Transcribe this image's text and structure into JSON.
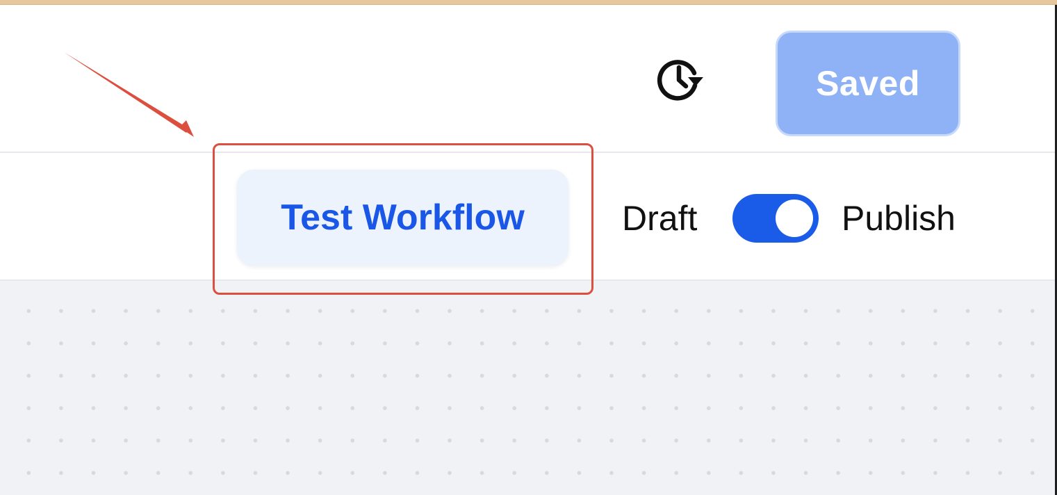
{
  "header": {
    "history_icon": "clock-rotate-icon",
    "saved_label": "Saved"
  },
  "toolbar": {
    "test_workflow_label": "Test Workflow",
    "draft_label": "Draft",
    "publish_label": "Publish",
    "publish_toggle_on": true
  },
  "annotation": {
    "highlight_color": "#dc4f3e"
  },
  "colors": {
    "accent": "#1a5ce8",
    "saved_button_bg": "#8fb1f5",
    "test_button_bg": "#edf3fd",
    "test_button_text": "#1a57e6",
    "canvas_bg": "#f1f2f6"
  }
}
